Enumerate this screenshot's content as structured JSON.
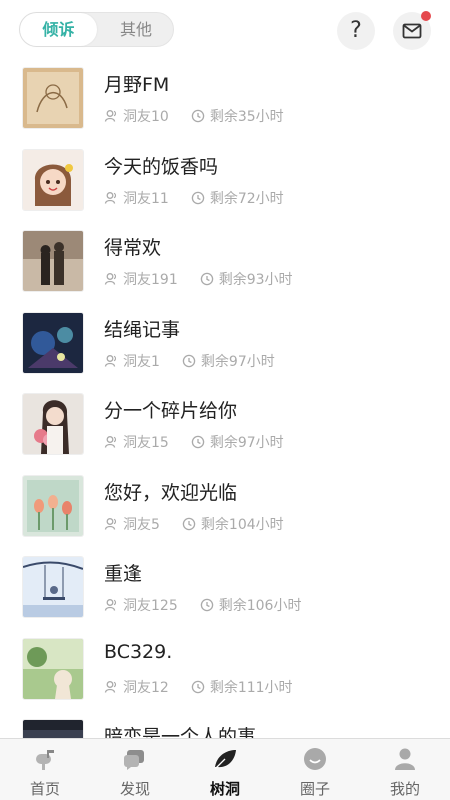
{
  "header": {
    "tabs": [
      {
        "label": "倾诉",
        "active": true
      },
      {
        "label": "其他",
        "active": false
      }
    ],
    "help_label": "?",
    "mail_has_notification": true,
    "accent_color": "#35b2a6",
    "badge_color": "#e5484d"
  },
  "list": [
    {
      "title": "月野FM",
      "friends": "洞友10",
      "remaining": "剩余35小时",
      "thumb_icon": "sketch-image"
    },
    {
      "title": "今天的饭香吗",
      "friends": "洞友11",
      "remaining": "剩余72小时",
      "thumb_icon": "anime-girl-image"
    },
    {
      "title": "得常欢",
      "friends": "洞友191",
      "remaining": "剩余93小时",
      "thumb_icon": "couple-photo"
    },
    {
      "title": "结绳记事",
      "friends": "洞友1",
      "remaining": "剩余97小时",
      "thumb_icon": "neon-scene-image"
    },
    {
      "title": "分一个碎片给你",
      "friends": "洞友15",
      "remaining": "剩余97小时",
      "thumb_icon": "girl-with-flowers-photo"
    },
    {
      "title": "您好，欢迎光临",
      "friends": "洞友5",
      "remaining": "剩余104小时",
      "thumb_icon": "tulip-painting"
    },
    {
      "title": "重逢",
      "friends": "洞友125",
      "remaining": "剩余106小时",
      "thumb_icon": "swing-illustration"
    },
    {
      "title": "BC329.",
      "friends": "洞友12",
      "remaining": "剩余111小时",
      "thumb_icon": "nature-figure-image"
    },
    {
      "title": "暗恋是一个人的事",
      "friends": "",
      "remaining": "",
      "thumb_icon": "dark-image"
    }
  ],
  "tabbar": [
    {
      "label": "首页",
      "icon": "mailbox-icon",
      "active": false
    },
    {
      "label": "发现",
      "icon": "chat-bubbles-icon",
      "active": false
    },
    {
      "label": "树洞",
      "icon": "leaf-icon",
      "active": true
    },
    {
      "label": "圈子",
      "icon": "circle-face-icon",
      "active": false
    },
    {
      "label": "我的",
      "icon": "person-icon",
      "active": false
    }
  ]
}
